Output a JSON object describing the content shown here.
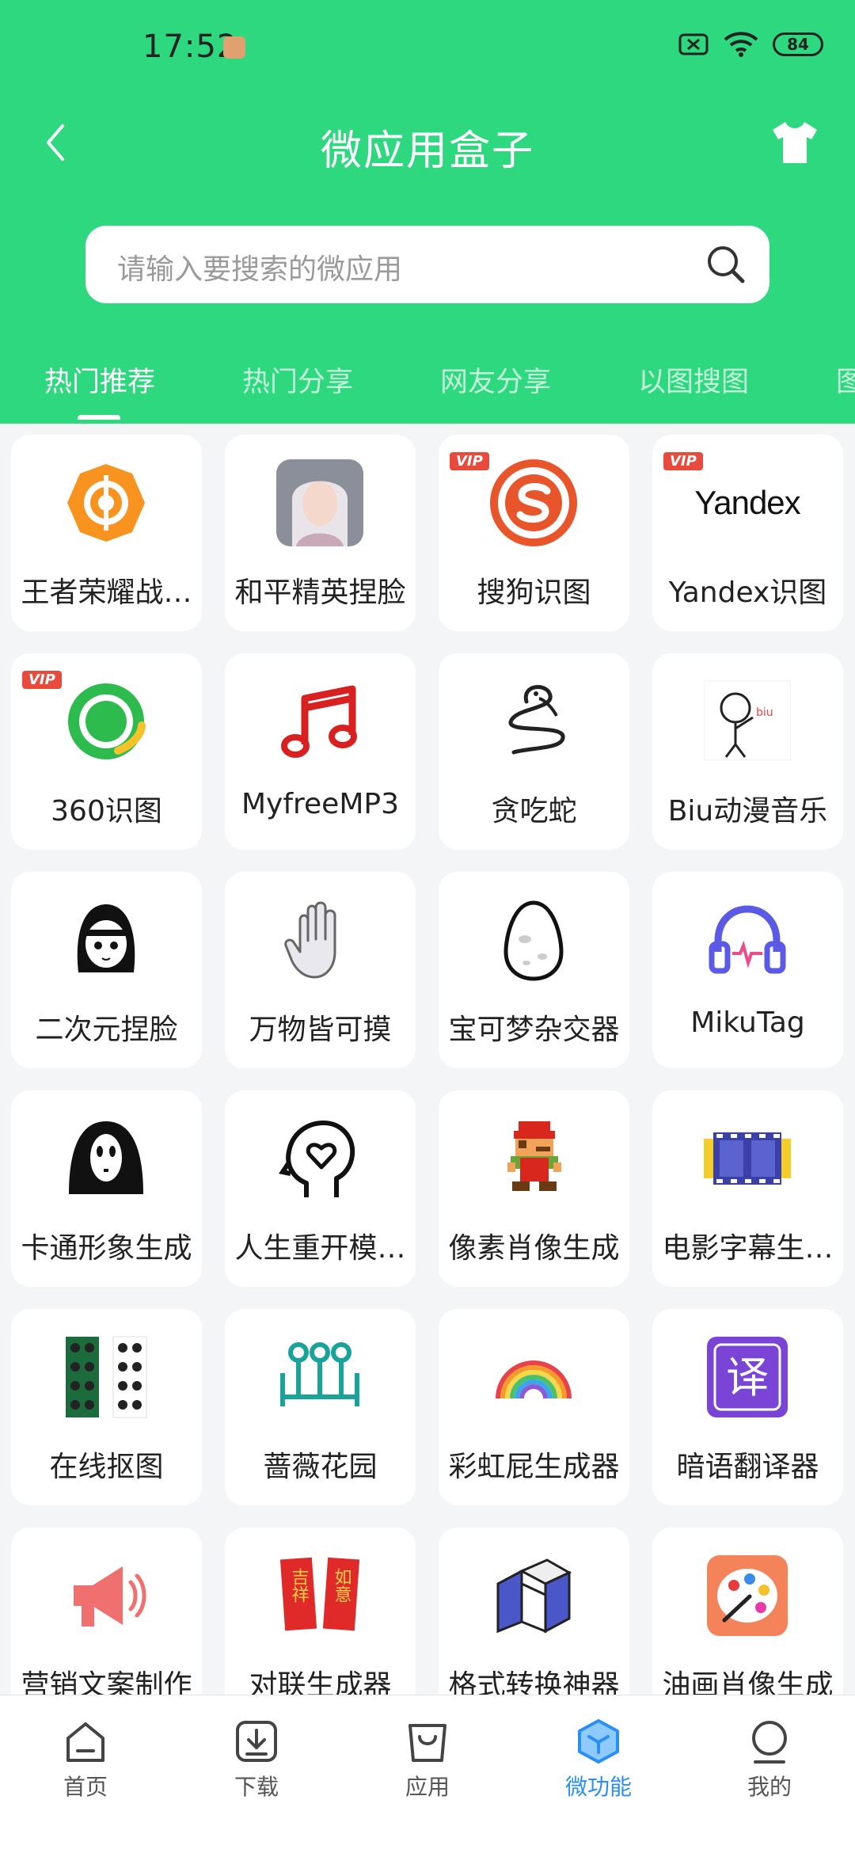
{
  "status": {
    "time": "17:52",
    "battery": "84"
  },
  "header": {
    "title": "微应用盒子"
  },
  "search": {
    "placeholder": "请输入要搜索的微应用"
  },
  "tabs": [
    {
      "label": "热门推荐"
    },
    {
      "label": "热门分享"
    },
    {
      "label": "网友分享"
    },
    {
      "label": "以图搜图"
    },
    {
      "label": "图"
    }
  ],
  "apps": [
    {
      "label": "王者荣耀战…",
      "icon": "target-flame-icon"
    },
    {
      "label": "和平精英捏脸",
      "icon": "avatar-face-icon"
    },
    {
      "label": "搜狗识图",
      "icon": "sogou-icon",
      "vip": "VIP"
    },
    {
      "label": "Yandex识图",
      "icon": "yandex-logo",
      "logo_text": "Yandex",
      "vip": "VIP"
    },
    {
      "label": "360识图",
      "icon": "360-icon",
      "vip": "VIP"
    },
    {
      "label": "MyfreeMP3",
      "icon": "music-note-icon"
    },
    {
      "label": "贪吃蛇",
      "icon": "snake-icon"
    },
    {
      "label": "Biu动漫音乐",
      "icon": "cartoon-person-icon",
      "icon_text": "biu"
    },
    {
      "label": "二次元捏脸",
      "icon": "anime-girl-icon"
    },
    {
      "label": "万物皆可摸",
      "icon": "hand-icon"
    },
    {
      "label": "宝可梦杂交器",
      "icon": "egg-icon"
    },
    {
      "label": "MikuTag",
      "icon": "headphones-icon"
    },
    {
      "label": "卡通形象生成",
      "icon": "ghost-mask-icon"
    },
    {
      "label": "人生重开模…",
      "icon": "head-heart-icon"
    },
    {
      "label": "像素肖像生成",
      "icon": "pixel-mario-icon"
    },
    {
      "label": "电影字幕生…",
      "icon": "film-strip-icon"
    },
    {
      "label": "在线抠图",
      "icon": "cutout-grid-icon"
    },
    {
      "label": "蔷薇花园",
      "icon": "garden-fence-icon"
    },
    {
      "label": "彩虹屁生成器",
      "icon": "rainbow-icon"
    },
    {
      "label": "暗语翻译器",
      "icon": "translate-icon",
      "icon_text": "译"
    },
    {
      "label": "营销文案制作",
      "icon": "megaphone-icon"
    },
    {
      "label": "对联生成器",
      "icon": "couplet-icon",
      "icon_text_a": "吉祥",
      "icon_text_b": "如意"
    },
    {
      "label": "格式转换神器",
      "icon": "convert-cube-icon"
    },
    {
      "label": "油画肖像生成",
      "icon": "palette-icon"
    }
  ],
  "nav": [
    {
      "label": "首页",
      "icon": "home-icon"
    },
    {
      "label": "下载",
      "icon": "download-icon"
    },
    {
      "label": "应用",
      "icon": "bag-icon"
    },
    {
      "label": "微功能",
      "icon": "cube-icon",
      "active": true
    },
    {
      "label": "我的",
      "icon": "profile-icon"
    }
  ],
  "colors": {
    "header": "#2ed87e",
    "active": "#2a8ff5",
    "vip": "#e84b3c"
  }
}
